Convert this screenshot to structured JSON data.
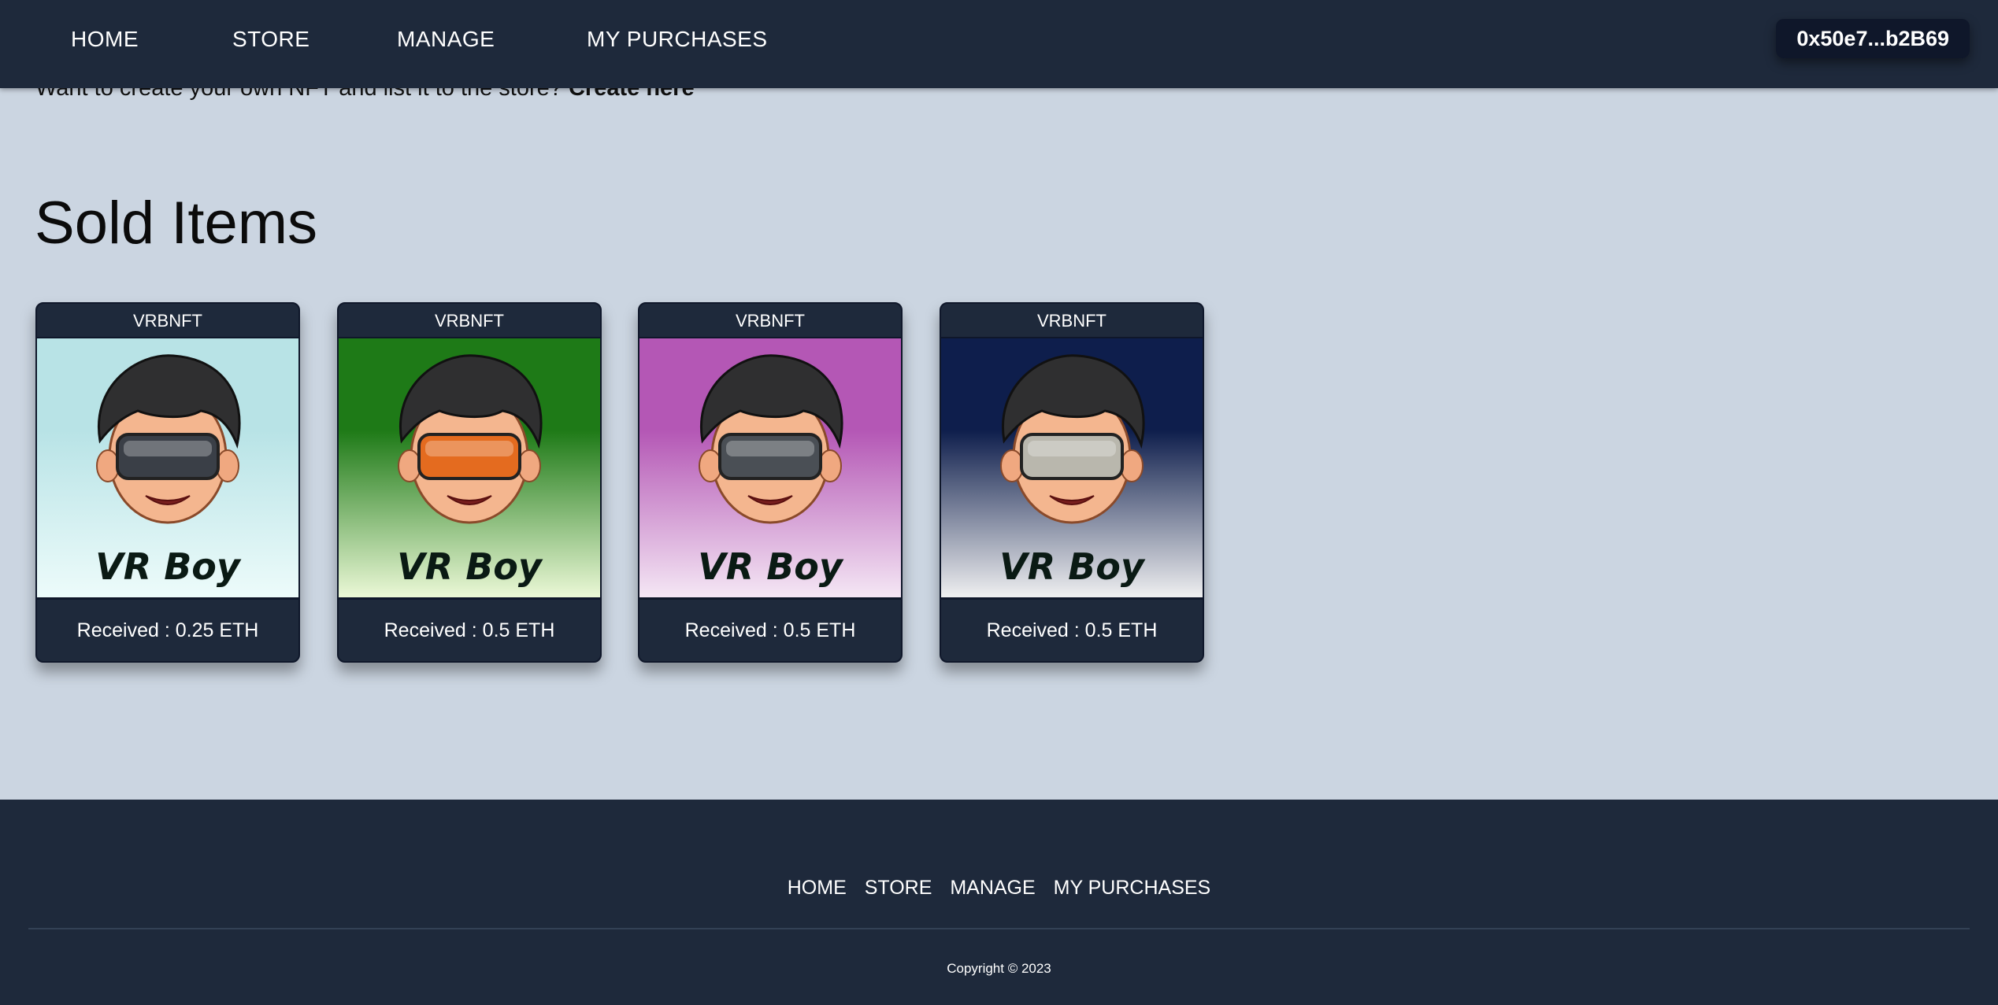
{
  "nav": {
    "home": "HOME",
    "store": "STORE",
    "manage": "MANAGE",
    "purchases": "MY PURCHASES",
    "wallet": "0x50e7...b2B69"
  },
  "banner": {
    "text": "Want to create your own NFT and list it to the store?",
    "link": "Create here"
  },
  "section_title": "Sold Items",
  "cards": [
    {
      "collection": "VRBNFT",
      "art_text": "VR Boy",
      "price": "Received : 0.25 ETH",
      "bg_top": "#b8e3e6",
      "bg_bottom": "#eefcfb",
      "visor": "#3a3f47"
    },
    {
      "collection": "VRBNFT",
      "art_text": "VR Boy",
      "price": "Received : 0.5 ETH",
      "bg_top": "#1e7a17",
      "bg_bottom": "#f0fbdb",
      "visor": "#e46b1f"
    },
    {
      "collection": "VRBNFT",
      "art_text": "VR Boy",
      "price": "Received : 0.5 ETH",
      "bg_top": "#b457b5",
      "bg_bottom": "#f6eaf6",
      "visor": "#4a4f55"
    },
    {
      "collection": "VRBNFT",
      "art_text": "VR Boy",
      "price": "Received : 0.5 ETH",
      "bg_top": "#0e1e4c",
      "bg_bottom": "#f4f4f4",
      "visor": "#b9b7ad"
    }
  ],
  "footer": {
    "home": "HOME",
    "store": "STORE",
    "manage": "MANAGE",
    "purchases": "MY PURCHASES",
    "copyright": "Copyright © 2023"
  }
}
